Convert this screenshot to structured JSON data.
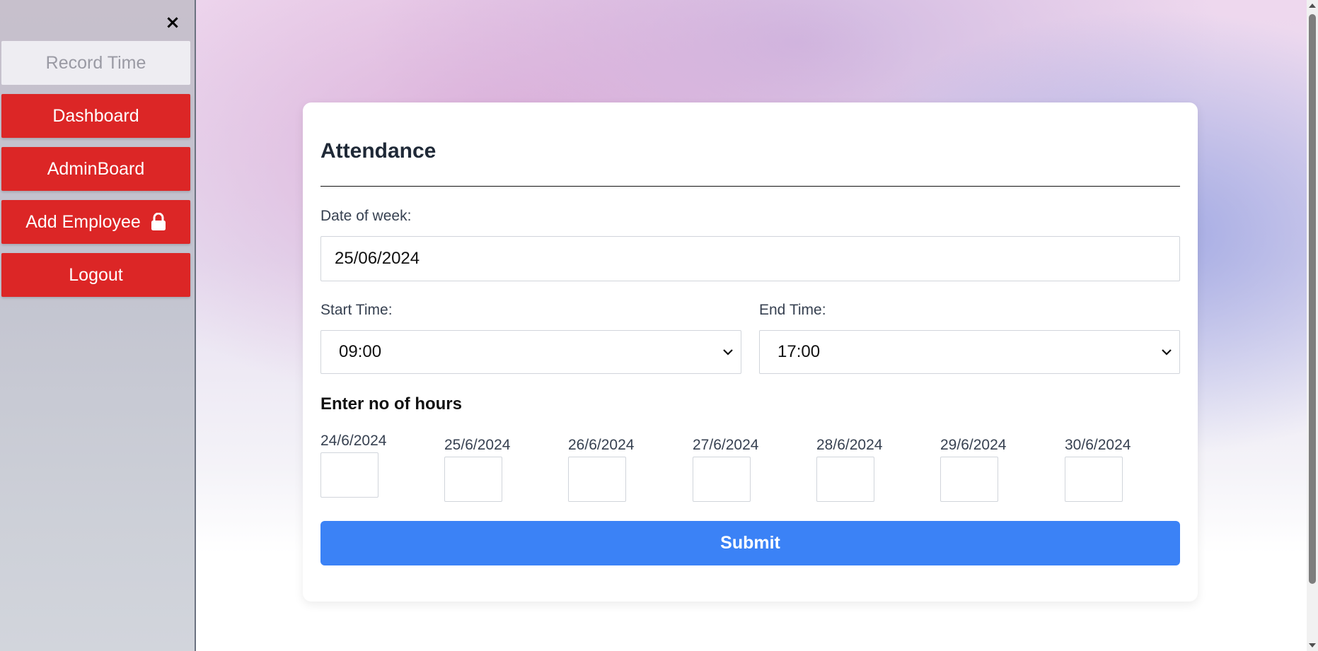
{
  "sidebar": {
    "close_icon": "×",
    "items": [
      {
        "label": "Record Time",
        "state": "active"
      },
      {
        "label": "Dashboard"
      },
      {
        "label": "AdminBoard"
      },
      {
        "label": "Add Employee",
        "icon": "lock-icon"
      },
      {
        "label": "Logout"
      }
    ],
    "colors": {
      "button": "#dc2626",
      "active_bg": "#eeedf2",
      "active_text": "#9a9aa4"
    }
  },
  "form": {
    "title": "Attendance",
    "date_label": "Date of week:",
    "date_value": "25/06/2024",
    "start_label": "Start Time:",
    "start_value": "09:00",
    "end_label": "End Time:",
    "end_value": "17:00",
    "hours_heading": "Enter no of hours",
    "days": [
      {
        "date": "24/6/2024",
        "hours": ""
      },
      {
        "date": "25/6/2024",
        "hours": ""
      },
      {
        "date": "26/6/2024",
        "hours": ""
      },
      {
        "date": "27/6/2024",
        "hours": ""
      },
      {
        "date": "28/6/2024",
        "hours": ""
      },
      {
        "date": "29/6/2024",
        "hours": ""
      },
      {
        "date": "30/6/2024",
        "hours": ""
      }
    ],
    "submit_label": "Submit",
    "colors": {
      "submit": "#3b82f6"
    }
  }
}
